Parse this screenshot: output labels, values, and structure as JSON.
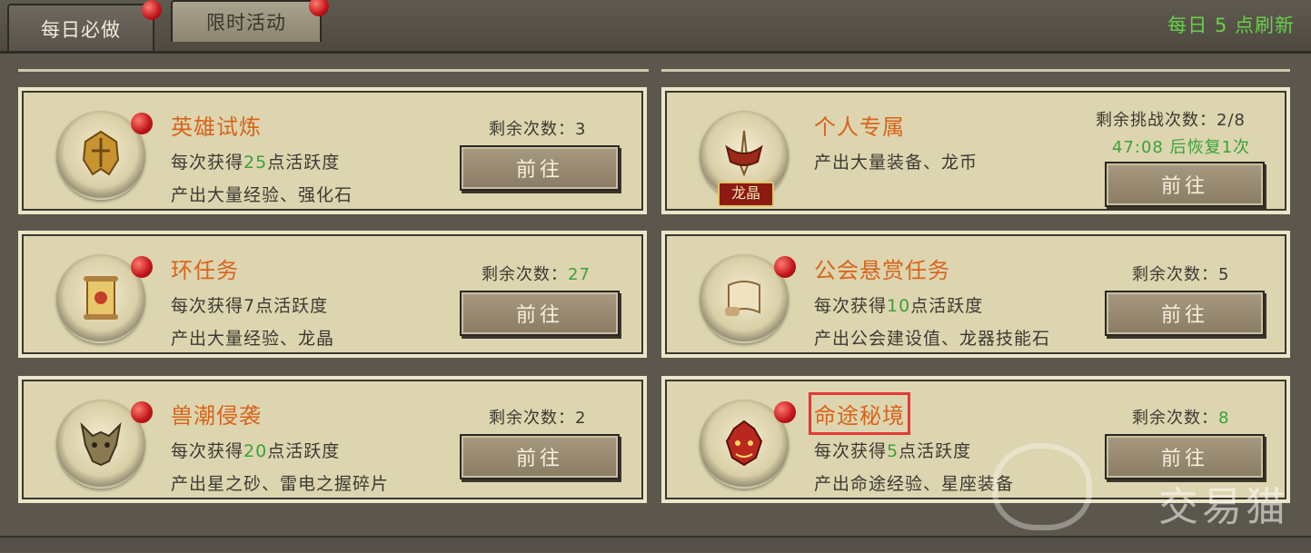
{
  "tabs": [
    {
      "label": "每日必做",
      "active": true
    },
    {
      "label": "限时活动",
      "active": false
    }
  ],
  "refresh_text": "每日 5 点刷新",
  "go_label": "前往",
  "cards": [
    {
      "title": "英雄试炼",
      "line1_pre": "每次获得",
      "line1_num": "25",
      "line1_post": "点活跃度",
      "line2": "产出大量经验、强化石",
      "remain_label": "剩余次数：",
      "remain_value": "3",
      "remain_green": false,
      "icon": "helmet-icon"
    },
    {
      "title": "个人专属",
      "line1_pre": "产出大量装备、龙币",
      "line1_num": "",
      "line1_post": "",
      "line2": "",
      "remain_label": "剩余挑战次数：",
      "remain_value": "2/8",
      "remain_green": false,
      "recover_text": "47:08 后恢复1次",
      "badge": "龙晶",
      "icon": "sword-crest-icon"
    },
    {
      "title": "环任务",
      "line1_pre": "每次获得7点活跃度",
      "line1_num": "",
      "line1_post": "",
      "line2": "产出大量经验、龙晶",
      "remain_label": "剩余次数：",
      "remain_value": "27",
      "remain_green": true,
      "icon": "scroll-icon"
    },
    {
      "title": "公会悬赏任务",
      "line1_pre": "每次获得",
      "line1_num": "10",
      "line1_post": "点活跃度",
      "line2": "产出公会建设值、龙器技能石",
      "remain_label": "剩余次数：",
      "remain_value": "5",
      "remain_green": false,
      "icon": "parchment-icon"
    },
    {
      "title": "兽潮侵袭",
      "line1_pre": "每次获得",
      "line1_num": "20",
      "line1_post": "点活跃度",
      "line2": "产出星之砂、雷电之握碎片",
      "remain_label": "剩余次数：",
      "remain_value": "2",
      "remain_green": false,
      "icon": "beast-mask-icon"
    },
    {
      "title": "命途秘境",
      "line1_pre": "每次获得",
      "line1_num": "5",
      "line1_post": "点活跃度",
      "line2": "产出命途经验、星座装备",
      "remain_label": "剩余次数：",
      "remain_value": "8",
      "remain_green": true,
      "icon": "demon-head-icon",
      "highlighted": true
    }
  ],
  "watermark": "交易猫",
  "colors": {
    "accent_title": "#d8641d",
    "highlight_green": "#3aa23a",
    "refresh_green": "#67d14a",
    "card_bg": "#ddd5af"
  }
}
